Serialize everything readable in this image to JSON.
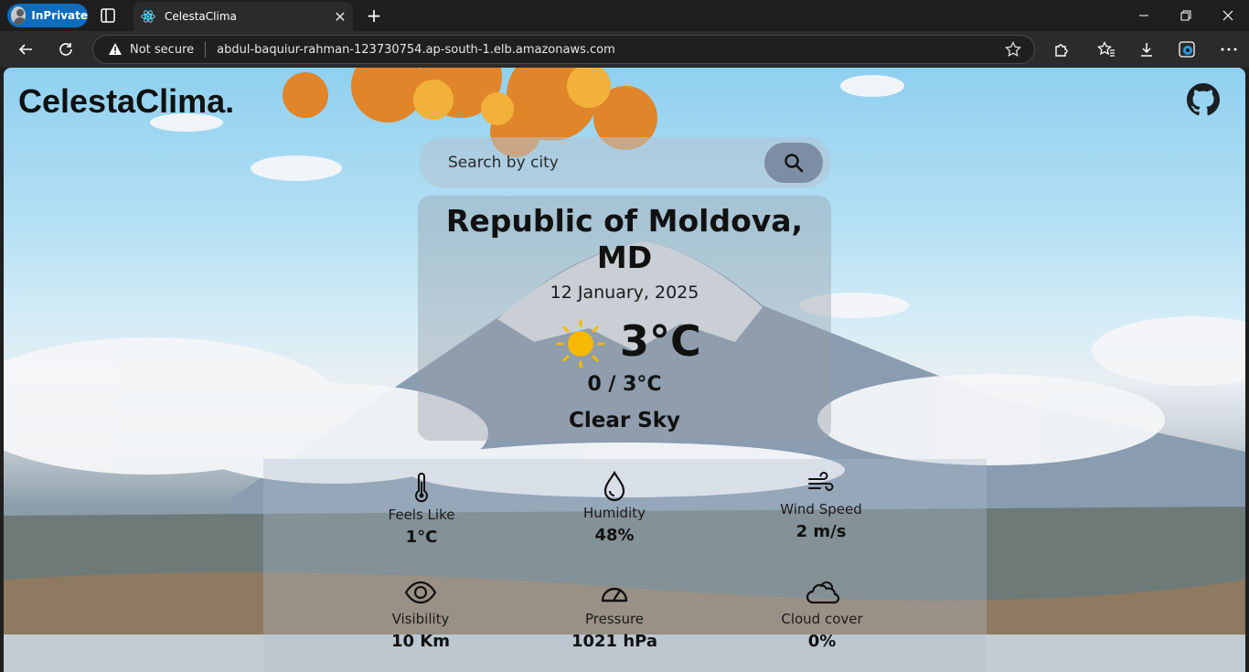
{
  "browser": {
    "inprivate_label": "InPrivate",
    "tab_title": "CelestaClima",
    "security_label": "Not secure",
    "url": "abdul-baquiur-rahman-123730754.ap-south-1.elb.amazonaws.com"
  },
  "header": {
    "logo": "CelestaClima."
  },
  "search": {
    "placeholder": "Search by city"
  },
  "weather": {
    "city": "Republic of Moldova, MD",
    "date": "12 January, 2025",
    "temperature": "3°C",
    "min_max": "0 / 3°C",
    "condition": "Clear Sky"
  },
  "details": [
    {
      "label": "Feels Like",
      "value": "1°C",
      "icon": "thermometer-icon"
    },
    {
      "label": "Humidity",
      "value": "48%",
      "icon": "droplet-icon"
    },
    {
      "label": "Wind Speed",
      "value": "2 m/s",
      "icon": "wind-icon"
    },
    {
      "label": "Visibility",
      "value": "10 Km",
      "icon": "eye-icon"
    },
    {
      "label": "Pressure",
      "value": "1021 hPa",
      "icon": "gauge-icon"
    },
    {
      "label": "Cloud cover",
      "value": "0%",
      "icon": "cloud-icon"
    }
  ],
  "colors": {
    "inprivate": "#0f6cbd",
    "sun": "#f6b800",
    "search_button": "#7d8ea4"
  }
}
